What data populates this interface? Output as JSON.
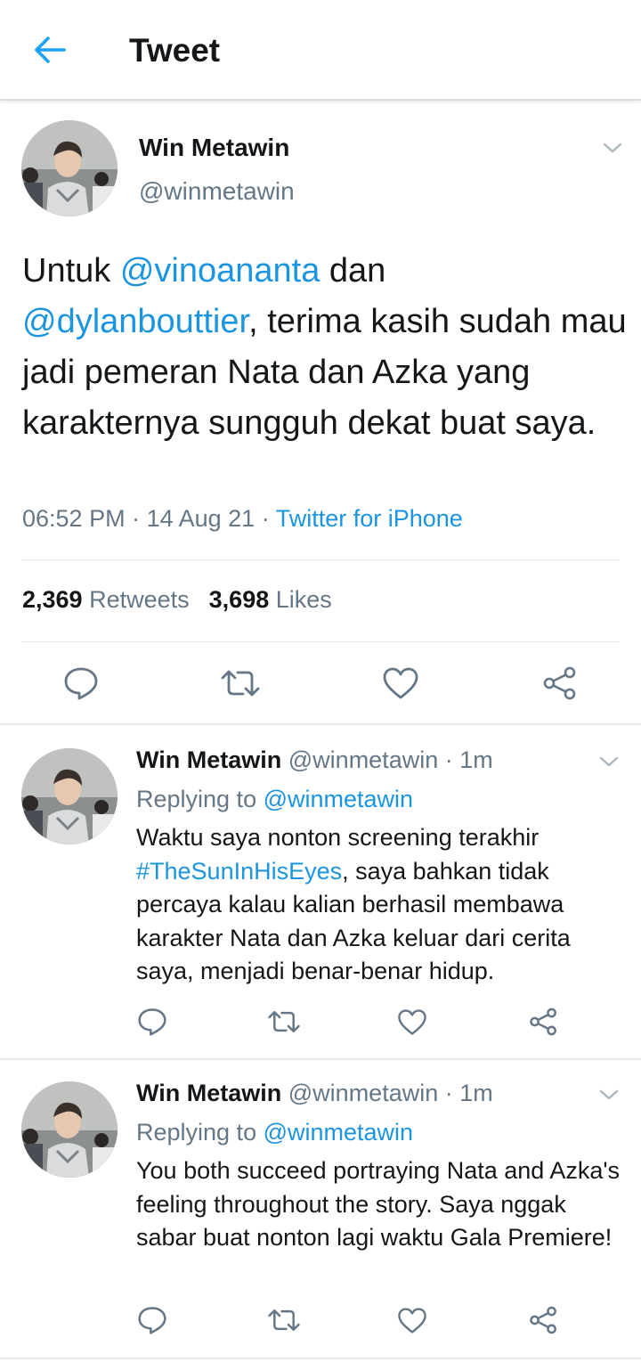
{
  "header": {
    "title": "Tweet",
    "back_icon": "arrow-left-icon",
    "accent": "#1da1f2"
  },
  "main_tweet": {
    "name": "Win Metawin",
    "handle": "@winmetawin",
    "text_parts": {
      "p1": "Untuk ",
      "mention1": "@vinoananta",
      "p2": " dan ",
      "mention2": "@dylanbouttier",
      "p3": ", terima kasih sudah mau jadi pemeran Nata dan Azka yang karakternya sungguh dekat buat saya."
    },
    "time": "06:52 PM",
    "sep1": " · ",
    "date": "14 Aug 21",
    "sep2": " · ",
    "source": "Twitter for iPhone",
    "retweets_count": "2,369",
    "retweets_label": "Retweets",
    "likes_count": "3,698",
    "likes_label": "Likes"
  },
  "replies": [
    {
      "name": "Win Metawin",
      "handle_time": " @winmetawin · 1m",
      "replying_label": "Replying to ",
      "replying_handle": "@winmetawin",
      "text_a": "Waktu saya nonton screening terakhir ",
      "hashtag": "#TheSunInHisEyes",
      "text_b": ", saya bahkan tidak percaya kalau kalian berhasil membawa karakter Nata dan Azka keluar dari cerita saya, menjadi benar-benar hidup."
    },
    {
      "name": "Win Metawin",
      "handle_time": " @winmetawin · 1m",
      "replying_label": "Replying to ",
      "replying_handle": "@winmetawin",
      "text": "You both succeed portraying Nata and Azka's feeling throughout the story. Saya nggak sabar buat nonton lagi waktu Gala Premiere!"
    }
  ],
  "colors": {
    "text": "#14171a",
    "secondary": "#657786",
    "link": "#1b95e0",
    "divider": "#e1e8ed"
  }
}
